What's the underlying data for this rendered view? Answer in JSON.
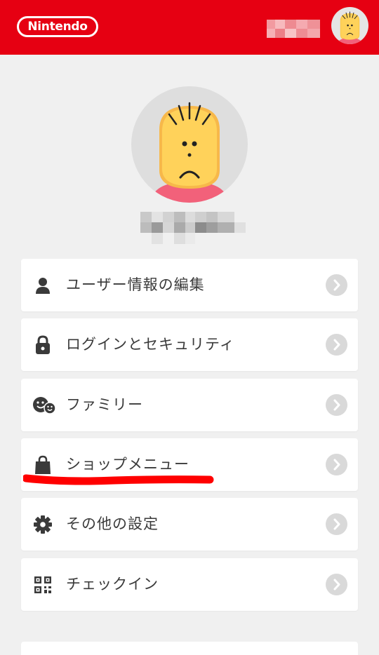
{
  "header": {
    "logo_text": "Nintendo",
    "brand_color": "#e60012"
  },
  "profile": {
    "avatar_icon": "mii-avatar"
  },
  "menu": {
    "items": [
      {
        "label": "ユーザー情報の編集",
        "icon": "person-icon"
      },
      {
        "label": "ログインとセキュリティ",
        "icon": "lock-icon"
      },
      {
        "label": "ファミリー",
        "icon": "family-icon"
      },
      {
        "label": "ショップメニュー",
        "icon": "shopping-bag-icon"
      },
      {
        "label": "その他の設定",
        "icon": "gear-icon"
      },
      {
        "label": "チェックイン",
        "icon": "qr-code-icon"
      }
    ]
  },
  "annotation": {
    "highlight_color": "#ff0000"
  }
}
